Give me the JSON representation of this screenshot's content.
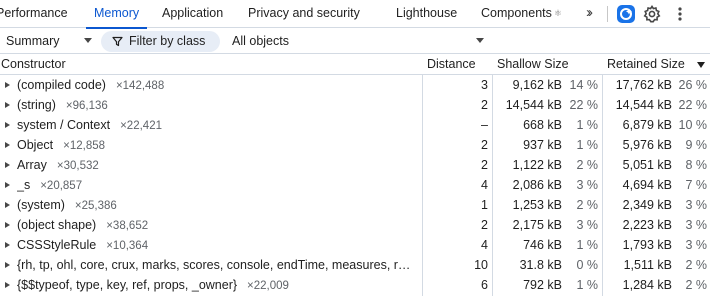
{
  "tabs": [
    {
      "label": "Performance"
    },
    {
      "label": "Memory"
    },
    {
      "label": "Application"
    },
    {
      "label": "Privacy and security"
    },
    {
      "label": "Lighthouse"
    },
    {
      "label": "Components"
    }
  ],
  "active_tab": "Memory",
  "components_badge": "⚛",
  "more_tabs_icon": "chevron-double-right-icon",
  "toolbar_icons": [
    "ai-assistance-icon",
    "gear-icon",
    "kebab-menu-icon"
  ],
  "accent_color": "#0b57d0",
  "toolbar": {
    "view_select": "Summary",
    "filter_label": "Filter by class",
    "objects_select": "All objects"
  },
  "table": {
    "columns": {
      "constructor": "Constructor",
      "distance": "Distance",
      "shallow": "Shallow Size",
      "retained": "Retained Size"
    },
    "sort": {
      "column": "Retained Size",
      "direction": "descending"
    },
    "rows": [
      {
        "name": "(compiled code)",
        "count": "×142,488",
        "distance": "3",
        "shallow": "9,162 kB",
        "shallow_pct": "14 %",
        "retained": "17,762 kB",
        "retained_pct": "26 %"
      },
      {
        "name": "(string)",
        "count": "×96,136",
        "distance": "2",
        "shallow": "14,544 kB",
        "shallow_pct": "22 %",
        "retained": "14,544 kB",
        "retained_pct": "22 %"
      },
      {
        "name": "system / Context",
        "count": "×22,421",
        "distance": "–",
        "shallow": "668 kB",
        "shallow_pct": "1 %",
        "retained": "6,879 kB",
        "retained_pct": "10 %"
      },
      {
        "name": "Object",
        "count": "×12,858",
        "distance": "2",
        "shallow": "937 kB",
        "shallow_pct": "1 %",
        "retained": "5,976 kB",
        "retained_pct": "9 %"
      },
      {
        "name": "Array",
        "count": "×30,532",
        "distance": "2",
        "shallow": "1,122 kB",
        "shallow_pct": "2 %",
        "retained": "5,051 kB",
        "retained_pct": "8 %"
      },
      {
        "name": "_s",
        "count": "×20,857",
        "distance": "4",
        "shallow": "2,086 kB",
        "shallow_pct": "3 %",
        "retained": "4,694 kB",
        "retained_pct": "7 %"
      },
      {
        "name": "(system)",
        "count": "×25,386",
        "distance": "1",
        "shallow": "1,253 kB",
        "shallow_pct": "2 %",
        "retained": "2,349 kB",
        "retained_pct": "3 %"
      },
      {
        "name": "(object shape)",
        "count": "×38,652",
        "distance": "2",
        "shallow": "2,175 kB",
        "shallow_pct": "3 %",
        "retained": "2,223 kB",
        "retained_pct": "3 %"
      },
      {
        "name": "CSSStyleRule",
        "count": "×10,364",
        "distance": "4",
        "shallow": "746 kB",
        "shallow_pct": "1 %",
        "retained": "1,793 kB",
        "retained_pct": "3 %"
      },
      {
        "name": "{rh, tp, ohl, core, crux, marks, scores, console, endTime, measures, r…",
        "count": "",
        "distance": "10",
        "shallow": "31.8 kB",
        "shallow_pct": "0 %",
        "retained": "1,511 kB",
        "retained_pct": "2 %"
      },
      {
        "name": "{$$typeof, type, key, ref, props, _owner}",
        "count": "×22,009",
        "distance": "6",
        "shallow": "792 kB",
        "shallow_pct": "1 %",
        "retained": "1,284 kB",
        "retained_pct": "2 %"
      }
    ]
  }
}
